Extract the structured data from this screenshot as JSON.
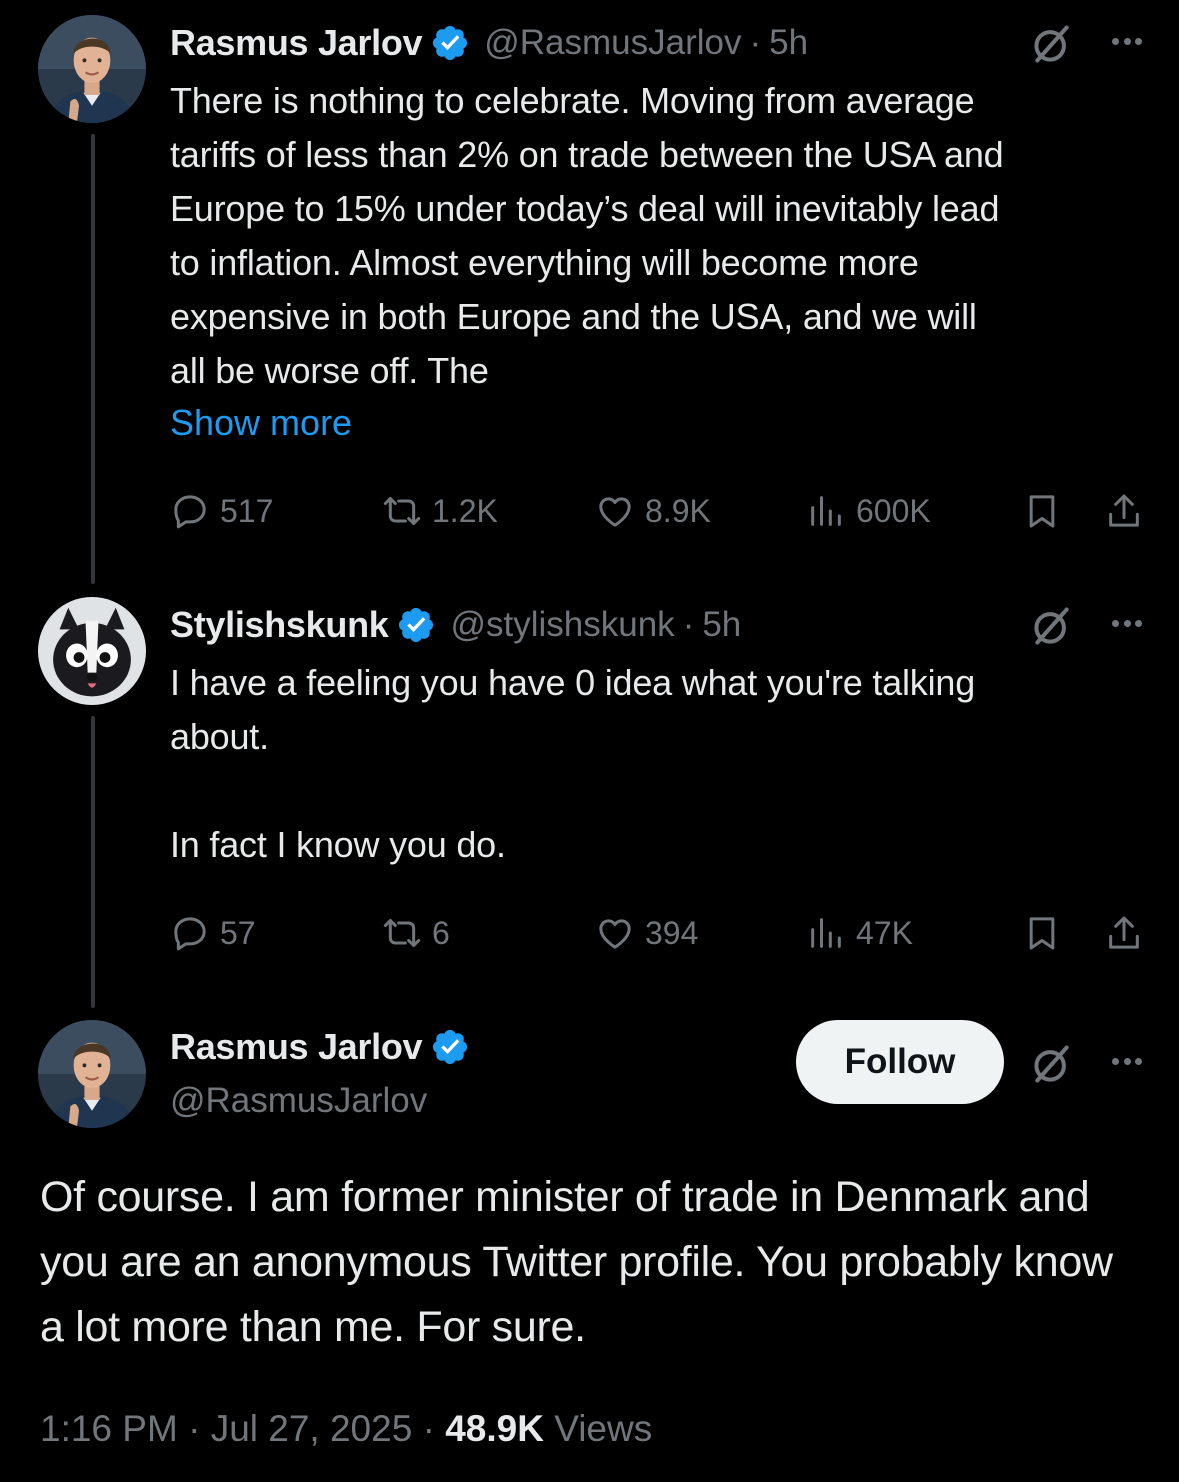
{
  "tweets": [
    {
      "name": "Rasmus Jarlov",
      "handle": "@RasmusJarlov",
      "time": "5h",
      "text": "There is nothing to celebrate. Moving from average\ntariffs of less than 2% on trade between the USA and\nEurope to 15% under today’s deal will inevitably lead\nto inflation. Almost everything will become more\nexpensive in both Europe and the USA, and we will\nall be worse off. The",
      "show_more": "Show more",
      "stats": {
        "replies": "517",
        "reposts": "1.2K",
        "likes": "8.9K",
        "views": "600K"
      }
    },
    {
      "name": "Stylishskunk",
      "handle": "@stylishskunk",
      "time": "5h",
      "text": "I have a feeling you have 0 idea what you're talking\nabout.\n\nIn fact I know you do.",
      "stats": {
        "replies": "57",
        "reposts": "6",
        "likes": "394",
        "views": "47K"
      }
    }
  ],
  "main_tweet": {
    "name": "Rasmus Jarlov",
    "handle": "@RasmusJarlov",
    "follow_label": "Follow",
    "text": "Of course. I am former minister of trade in Denmark and you are an anonymous Twitter profile. You probably know a lot more than me. For sure.",
    "time": "1:16 PM",
    "date": "Jul 27, 2025",
    "views_count": "48.9K",
    "views_label": "Views"
  },
  "colors": {
    "background": "#000000",
    "text": "#e7e9ea",
    "muted": "#71767b",
    "link": "#1d9bf0",
    "verified": "#1d9bf0"
  },
  "icons": [
    "verified-badge-icon",
    "grok-icon",
    "more-icon",
    "reply-icon",
    "repost-icon",
    "like-icon",
    "views-icon",
    "bookmark-icon",
    "share-icon"
  ]
}
